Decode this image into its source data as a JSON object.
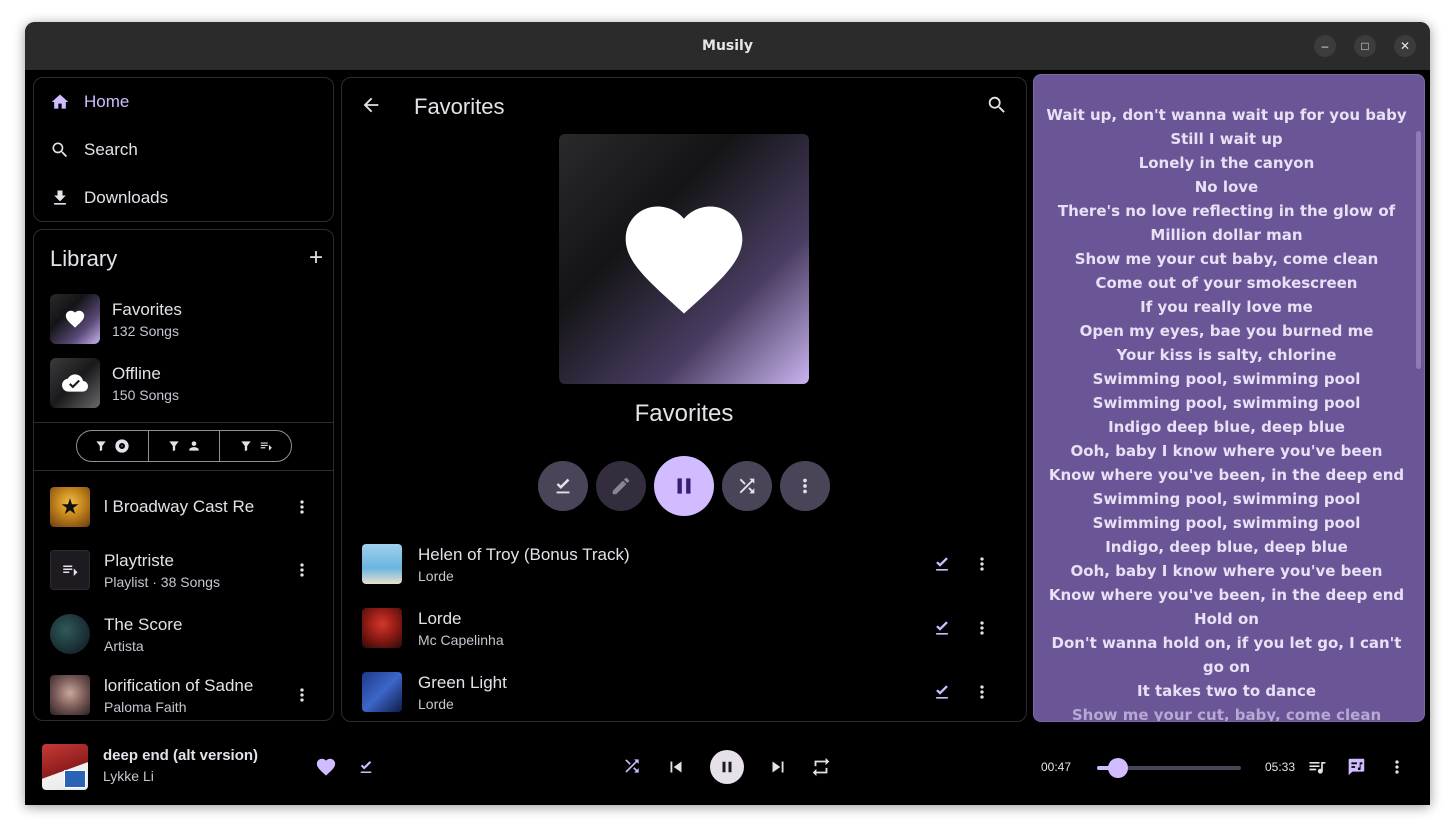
{
  "window": {
    "title": "Musily"
  },
  "nav": {
    "home": "Home",
    "search": "Search",
    "downloads": "Downloads"
  },
  "library": {
    "title": "Library",
    "add": "+",
    "pinned": [
      {
        "name": "Favorites",
        "sub": "132 Songs"
      },
      {
        "name": "Offline",
        "sub": "150 Songs"
      }
    ],
    "items": [
      {
        "name": "l Broadway Cast Re",
        "sub": ""
      },
      {
        "name": "Playtriste",
        "sub": "Playlist · 38 Songs"
      },
      {
        "name": "The Score",
        "sub": "Artista"
      },
      {
        "name": "lorification of Sadne",
        "sub": "Paloma Faith"
      }
    ]
  },
  "main": {
    "title": "Favorites",
    "playlist_name": "Favorites",
    "tracks": [
      {
        "title": "Helen of Troy (Bonus Track)",
        "artist": "Lorde"
      },
      {
        "title": "Lorde",
        "artist": "Mc Capelinha"
      },
      {
        "title": "Green Light",
        "artist": "Lorde"
      }
    ]
  },
  "lyrics": [
    "Wait up, don't wanna wait up for you baby",
    "Still I wait up",
    "Lonely in the canyon",
    "No love",
    "There's no love reflecting in the glow of",
    "Million dollar man",
    "Show me your cut baby, come clean",
    "Come out of your smokescreen",
    "If you really love me",
    "Open my eyes, bae you burned me",
    "Your kiss is salty, chlorine",
    "Swimming pool, swimming pool",
    "Swimming pool, swimming pool",
    "Indigo deep blue, deep blue",
    "Ooh, baby I know where you've been",
    "Know where you've been, in the deep end",
    "Swimming pool, swimming pool",
    "Swimming pool, swimming pool",
    "Indigo, deep blue, deep blue",
    "Ooh, baby I know where you've been",
    "Know where you've been, in the deep end",
    "Hold on",
    "Don't wanna hold on, if you let go, I can't",
    "go on",
    "It takes two to dance",
    "Show me your cut, baby, come clean"
  ],
  "player": {
    "title": "deep end (alt version)",
    "artist": "Lykke Li",
    "elapsed": "00:47",
    "duration": "05:33",
    "progress": 0.147
  },
  "colors": {
    "accent": "#d0bcff",
    "lyrics_bg": "#6a5596"
  }
}
